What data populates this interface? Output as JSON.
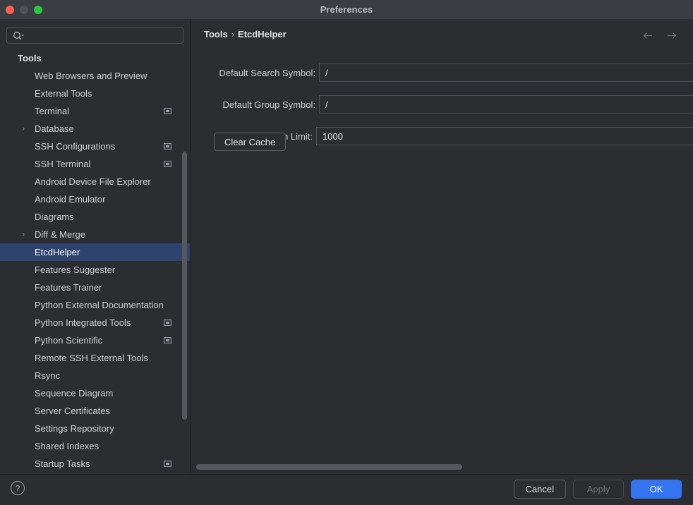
{
  "window": {
    "title": "Preferences",
    "controls": [
      "close",
      "minimize",
      "maximize"
    ]
  },
  "sidebar": {
    "search": {
      "value": "",
      "placeholder": ""
    },
    "group_label": "Tools",
    "items": [
      {
        "label": "Web Browsers and Preview",
        "expandable": false,
        "badge": false,
        "selected": false
      },
      {
        "label": "External Tools",
        "expandable": false,
        "badge": false,
        "selected": false
      },
      {
        "label": "Terminal",
        "expandable": false,
        "badge": true,
        "selected": false
      },
      {
        "label": "Database",
        "expandable": true,
        "badge": false,
        "selected": false
      },
      {
        "label": "SSH Configurations",
        "expandable": false,
        "badge": true,
        "selected": false
      },
      {
        "label": "SSH Terminal",
        "expandable": false,
        "badge": true,
        "selected": false
      },
      {
        "label": "Android Device File Explorer",
        "expandable": false,
        "badge": false,
        "selected": false
      },
      {
        "label": "Android Emulator",
        "expandable": false,
        "badge": false,
        "selected": false
      },
      {
        "label": "Diagrams",
        "expandable": false,
        "badge": false,
        "selected": false
      },
      {
        "label": "Diff & Merge",
        "expandable": true,
        "badge": false,
        "selected": false
      },
      {
        "label": "EtcdHelper",
        "expandable": false,
        "badge": false,
        "selected": true
      },
      {
        "label": "Features Suggester",
        "expandable": false,
        "badge": false,
        "selected": false
      },
      {
        "label": "Features Trainer",
        "expandable": false,
        "badge": false,
        "selected": false
      },
      {
        "label": "Python External Documentation",
        "expandable": false,
        "badge": false,
        "selected": false
      },
      {
        "label": "Python Integrated Tools",
        "expandable": false,
        "badge": true,
        "selected": false
      },
      {
        "label": "Python Scientific",
        "expandable": false,
        "badge": true,
        "selected": false
      },
      {
        "label": "Remote SSH External Tools",
        "expandable": false,
        "badge": false,
        "selected": false
      },
      {
        "label": "Rsync",
        "expandable": false,
        "badge": false,
        "selected": false
      },
      {
        "label": "Sequence Diagram",
        "expandable": false,
        "badge": false,
        "selected": false
      },
      {
        "label": "Server Certificates",
        "expandable": false,
        "badge": false,
        "selected": false
      },
      {
        "label": "Settings Repository",
        "expandable": false,
        "badge": false,
        "selected": false
      },
      {
        "label": "Shared Indexes",
        "expandable": false,
        "badge": false,
        "selected": false
      },
      {
        "label": "Startup Tasks",
        "expandable": false,
        "badge": true,
        "selected": false
      }
    ]
  },
  "content": {
    "breadcrumb": {
      "root": "Tools",
      "separator": "›",
      "current": "EtcdHelper"
    },
    "nav": {
      "back": "←",
      "forward": "→"
    },
    "fields": [
      {
        "label": "Default Search Symbol:",
        "value": "/"
      },
      {
        "label": "Default Group Symbol:",
        "value": "/"
      },
      {
        "label": "Default Search Limit:",
        "value": "1000"
      }
    ],
    "clear_cache_label": "Clear Cache"
  },
  "footer": {
    "help_label": "?",
    "cancel_label": "Cancel",
    "apply_label": "Apply",
    "ok_label": "OK"
  },
  "colors": {
    "accent": "#3574f0",
    "selection": "#2e436e",
    "background": "#2b2d30",
    "titlebar": "#3a3d41",
    "text": "#dfe1e5"
  }
}
